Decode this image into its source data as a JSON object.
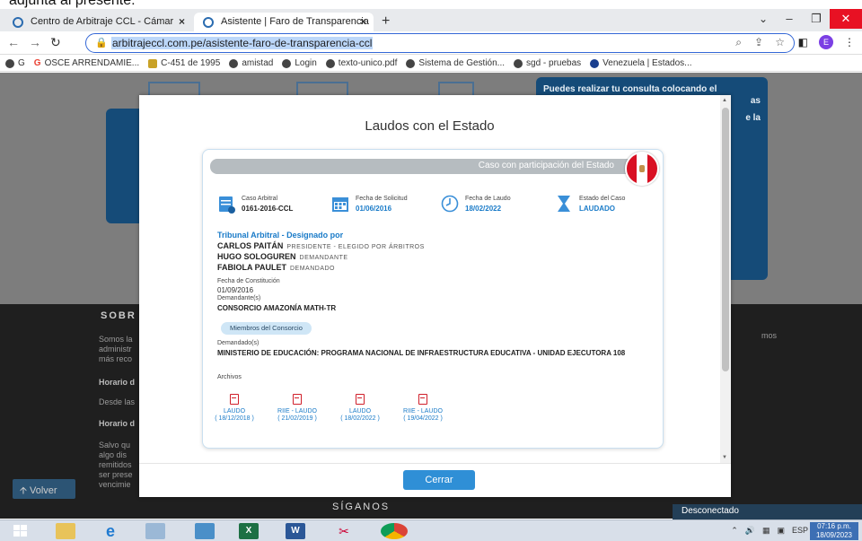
{
  "doc_top_text": "adjunta al presente:",
  "browser": {
    "tabs": [
      {
        "label": "Centro de Arbitraje CCL - Cámar"
      },
      {
        "label": "Asistente | Faro de Transparencia"
      }
    ],
    "new_tab": "+",
    "tab_close": "×",
    "url": "arbitrajeccl.com.pe/asistente-faro-de-transparencia-ccl",
    "profile_initial": "E",
    "bookmarks": [
      "G",
      "OSCE ARRENDAMIE...",
      "C-451 de 1995",
      "amistad",
      "Login",
      "texto-unico.pdf",
      "Sistema de Gestión...",
      "sgd - pruebas",
      "Venezuela | Estados..."
    ]
  },
  "background": {
    "card_right_text": "Puedes realizar tu consulta colocando el",
    "card_right_text2": "as",
    "card_right_text3": "e la",
    "sobre": "SOBR",
    "left_texts": [
      "Somos la",
      "administr",
      "más reco",
      "Horario d",
      "Desde las",
      "Horario d",
      "Salvo qu",
      "algo dis",
      "remitidos",
      "ser prese",
      "vencimie"
    ],
    "right_text": "mos",
    "volver": "Volver",
    "siganos": "SÍGANOS"
  },
  "modal": {
    "title": "Laudos con el Estado",
    "close_button": "Cerrar",
    "banner": "Caso con participación del Estado",
    "info": [
      {
        "label": "Caso Arbitral",
        "value": "0161-2016-CCL"
      },
      {
        "label": "Fecha de Solicitud",
        "value": "01/06/2016"
      },
      {
        "label": "Fecha de Laudo",
        "value": "18/02/2022"
      },
      {
        "label": "Estado del Caso",
        "value": "LAUDADO"
      }
    ],
    "tribunal_label": "Tribunal Arbitral - Designado por",
    "arbitros": [
      {
        "name": "CARLOS PAITÁN",
        "role": "PRESIDENTE - ELEGIDO POR ÁRBITROS"
      },
      {
        "name": "HUGO SOLOGUREN",
        "role": "DEMANDANTE"
      },
      {
        "name": "FABIOLA PAULET",
        "role": "DEMANDADO"
      }
    ],
    "constitucion_label": "Fecha de Constitución",
    "constitucion_value": "01/09/2016",
    "demandantes_label": "Demandante(s)",
    "demandante_value": "CONSORCIO AMAZONÍA MATH-TR",
    "consorcio_button": "Miembros del Consorcio",
    "demandados_label": "Demandado(s)",
    "demandado_value": "MINISTERIO DE EDUCACIÓN: PROGRAMA NACIONAL DE INFRAESTRUCTURA EDUCATIVA - UNIDAD EJECUTORA 108",
    "archivos_label": "Archivos",
    "files": [
      {
        "name": "LAUDO",
        "date": "( 18/12/2018 )"
      },
      {
        "name": "RIIE - LAUDO",
        "date": "( 21/02/2019 )"
      },
      {
        "name": "LAUDO",
        "date": "( 18/02/2022 )"
      },
      {
        "name": "RIIE - LAUDO",
        "date": "( 19/04/2022 )"
      }
    ]
  },
  "toast": "Desconectado",
  "taskbar": {
    "lang": "ESP",
    "time": "07:16 p.m.",
    "date": "18/09/2023"
  },
  "colors": {
    "accent_blue": "#1a7bc8",
    "button_blue": "#2f8fd6",
    "banner_gray": "#b6bcc0",
    "card_blue": "#154b78"
  }
}
